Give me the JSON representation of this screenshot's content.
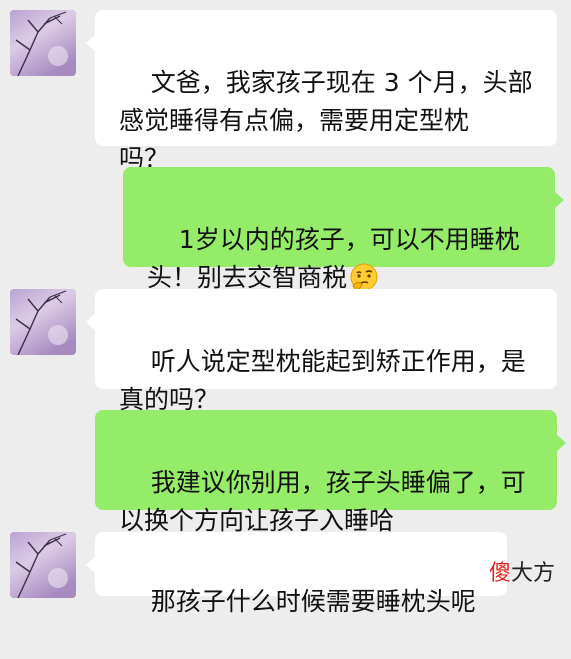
{
  "messages": [
    {
      "side": "left",
      "text": "文爸，我家孩子现在 3 个月，头部\n感觉睡得有点偏，需要用定型枕\n吗？"
    },
    {
      "side": "right",
      "text": "1岁以内的孩子，可以不用睡枕\n头！别去交智商税",
      "emoji": "thinking-face"
    },
    {
      "side": "left",
      "text": "听人说定型枕能起到矫正作用，是\n真的吗？"
    },
    {
      "side": "right",
      "text": "我建议你别用，孩子头睡偏了，可\n以换个方向让孩子入睡哈"
    },
    {
      "side": "left",
      "text": "那孩子什么时候需要睡枕头呢"
    }
  ],
  "watermark": {
    "accent": "傻",
    "rest": "大方"
  },
  "colors": {
    "background": "#ededed",
    "incoming_bubble": "#ffffff",
    "outgoing_bubble": "#95ec69"
  }
}
